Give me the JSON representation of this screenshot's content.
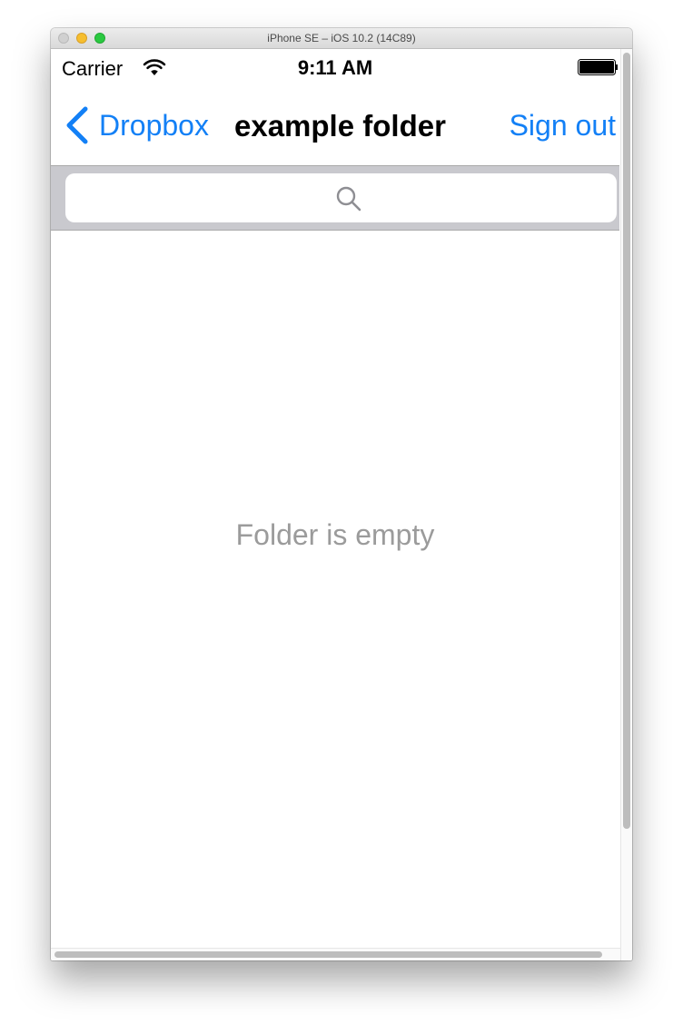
{
  "window": {
    "title": "iPhone SE – iOS 10.2 (14C89)"
  },
  "status_bar": {
    "carrier": "Carrier",
    "time": "9:11 AM",
    "wifi_icon": "wifi-icon",
    "battery_icon": "battery-icon"
  },
  "nav": {
    "back_label": "Dropbox",
    "back_icon": "chevron-left-icon",
    "title": "example folder",
    "right_button": "Sign out"
  },
  "search": {
    "placeholder": "",
    "icon": "search-icon"
  },
  "content": {
    "empty_message": "Folder is empty"
  },
  "colors": {
    "accent": "#1380f6",
    "empty_text": "#9b9b9b",
    "search_bar_bg": "#c9c9ce"
  }
}
